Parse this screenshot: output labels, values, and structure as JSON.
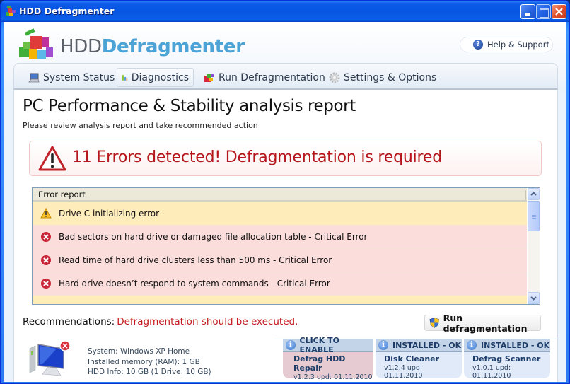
{
  "window": {
    "title": "HDD Defragmenter",
    "controls": {
      "minimize": "minimize",
      "maximize": "maximize",
      "close": "close"
    }
  },
  "brand": {
    "part1": "HDD",
    "part2": "Defragmenter"
  },
  "help": {
    "label": "Help & Support",
    "icon": "help-question-icon"
  },
  "tabs": [
    {
      "label": "System Status",
      "icon": "computer-icon",
      "active": false
    },
    {
      "label": "Diagnostics",
      "icon": "bar-chart-icon",
      "active": true
    },
    {
      "label": "Run Defragmentation",
      "icon": "defrag-blocks-icon",
      "active": false
    },
    {
      "label": "Settings & Options",
      "icon": "gear-icon",
      "active": false
    }
  ],
  "page": {
    "title": "PC Performance & Stability analysis report",
    "subtitle": "Please review analysis report and take recommended action"
  },
  "alert": {
    "text": "11 Errors detected! Defragmentation is required",
    "icon": "warning-triangle-icon",
    "color": "#b5161b"
  },
  "report": {
    "header": "Error report",
    "rows": [
      {
        "type": "warning",
        "text": "Drive C initializing error"
      },
      {
        "type": "error",
        "text": "Bad sectors on hard drive or damaged file allocation table - Critical Error"
      },
      {
        "type": "error",
        "text": "Read time of hard drive clusters less than 500 ms - Critical Error"
      },
      {
        "type": "error",
        "text": "Hard drive doesn’t respond to system commands - Critical Error"
      },
      {
        "type": "warning",
        "text": ""
      }
    ]
  },
  "recommendations": {
    "label": "Recommendations:",
    "value": "Defragmentation should be executed."
  },
  "run_button": {
    "label": "Run defragmentation"
  },
  "system_info": {
    "system": "System: Windows XP Home",
    "memory": "Installed memory (RAM): 1 GB",
    "hdd": "HDD Info: 10 GB (1 Drive: 10 GB)"
  },
  "modules": [
    {
      "status": "CLICK TO ENABLE",
      "name": "Defrag HDD Repair",
      "version": "v1.2.3 upd: 01.11.2010",
      "state": "disabled"
    },
    {
      "status": "INSTALLED - OK",
      "name": "Disk Cleaner",
      "version": "v1.2.4 upd: 01.11.2010",
      "state": "ok"
    },
    {
      "status": "INSTALLED - OK",
      "name": "Defrag Scanner",
      "version": "v1.0.1 upd: 01.11.2010",
      "state": "ok"
    }
  ],
  "colors": {
    "error_text": "#b5161b",
    "brand_accent": "#4ba3d6",
    "warning_row": "#feedbb",
    "error_row": "#fbdedc"
  }
}
